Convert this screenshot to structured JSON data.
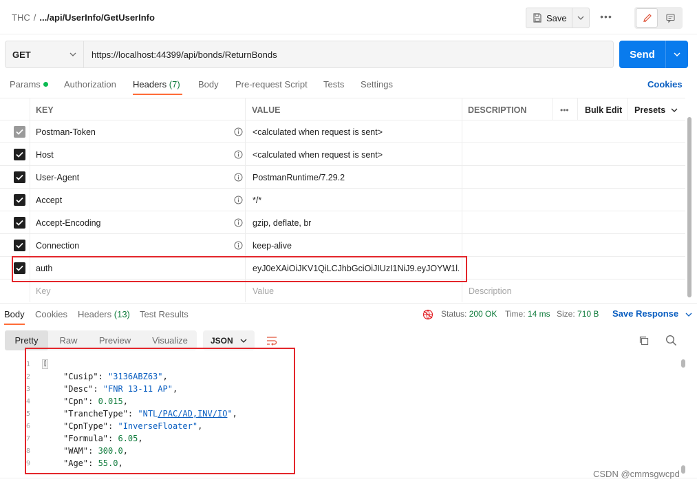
{
  "breadcrumb": {
    "workspace": "THC",
    "separator": "/",
    "request_name": ".../api/UserInfo/GetUserInfo"
  },
  "toolbar": {
    "save_label": "Save",
    "more_label": "•••"
  },
  "request": {
    "method": "GET",
    "url": "https://localhost:44399/api/bonds/ReturnBonds",
    "send_label": "Send"
  },
  "request_tabs": [
    {
      "label": "Params",
      "count": ""
    },
    {
      "label": "Authorization",
      "count": ""
    },
    {
      "label": "Headers",
      "count": "(7)"
    },
    {
      "label": "Body",
      "count": ""
    },
    {
      "label": "Pre-request Script",
      "count": ""
    },
    {
      "label": "Tests",
      "count": ""
    },
    {
      "label": "Settings",
      "count": ""
    }
  ],
  "cookies_label": "Cookies",
  "headers_table": {
    "columns": {
      "key": "KEY",
      "value": "VALUE",
      "description": "DESCRIPTION"
    },
    "more_label": "•••",
    "bulk_edit_label": "Bulk Edit",
    "presets_label": "Presets",
    "rows": [
      {
        "key": "Postman-Token",
        "value": "<calculated when request is sent>",
        "disabled": true
      },
      {
        "key": "Host",
        "value": "<calculated when request is sent>",
        "disabled": false
      },
      {
        "key": "User-Agent",
        "value": "PostmanRuntime/7.29.2",
        "disabled": false
      },
      {
        "key": "Accept",
        "value": "*/*",
        "disabled": false
      },
      {
        "key": "Accept-Encoding",
        "value": "gzip, deflate, br",
        "disabled": false
      },
      {
        "key": "Connection",
        "value": "keep-alive",
        "disabled": false
      },
      {
        "key": "auth",
        "value": "eyJ0eXAiOiJKV1QiLCJhbGciOiJIUzI1NiJ9.eyJOYW1l...",
        "disabled": false
      }
    ],
    "new_row": {
      "key_placeholder": "Key",
      "value_placeholder": "Value",
      "description_placeholder": "Description"
    }
  },
  "response_tabs": [
    {
      "label": "Body",
      "count": ""
    },
    {
      "label": "Cookies",
      "count": ""
    },
    {
      "label": "Headers",
      "count": "(13)"
    },
    {
      "label": "Test Results",
      "count": ""
    }
  ],
  "response_status": {
    "status_label": "Status:",
    "status_value": "200 OK",
    "time_label": "Time:",
    "time_value": "14 ms",
    "size_label": "Size:",
    "size_value": "710 B",
    "save_response_label": "Save Response"
  },
  "view_modes": [
    "Pretty",
    "Raw",
    "Preview",
    "Visualize"
  ],
  "format": "JSON",
  "response_body": [
    {
      "line": "1",
      "key": "",
      "value": "",
      "type": "brace"
    },
    {
      "line": "2",
      "key": "\"Cusip\"",
      "value": "\"3136ABZ63\"",
      "type": "string"
    },
    {
      "line": "3",
      "key": "\"Desc\"",
      "value": "\"FNR 13-11 AP\"",
      "type": "string"
    },
    {
      "line": "4",
      "key": "\"Cpn\"",
      "value": "0.015",
      "type": "number"
    },
    {
      "line": "5",
      "key": "\"TrancheType\"",
      "value": "\"NTL/PAC/AD,INV/IO\"",
      "type": "string"
    },
    {
      "line": "6",
      "key": "\"CpnType\"",
      "value": "\"InverseFloater\"",
      "type": "string"
    },
    {
      "line": "7",
      "key": "\"Formula\"",
      "value": "6.05",
      "type": "number"
    },
    {
      "line": "8",
      "key": "\"WAM\"",
      "value": "300.0",
      "type": "number"
    },
    {
      "line": "9",
      "key": "\"Age\"",
      "value": "55.0",
      "type": "number"
    }
  ],
  "watermark": "CSDN @cmmsgwcpd",
  "colors": {
    "accent": "#ff6c37",
    "send": "#097bed",
    "link": "#0b5fc1",
    "ok": "#0d7a3a",
    "annotation": "#e3262b"
  }
}
